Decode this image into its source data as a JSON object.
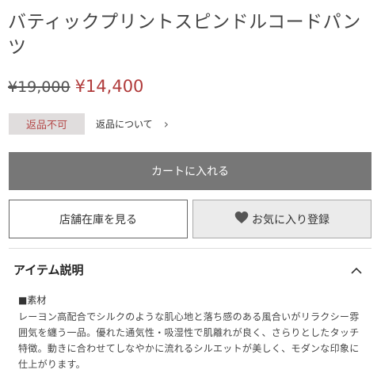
{
  "product": {
    "title": "バティックプリントスピンドルコードパンツ",
    "old_price": "¥19,000",
    "new_price": "¥14,400"
  },
  "returns": {
    "badge": "返品不可",
    "link": "返品について"
  },
  "buttons": {
    "cart": "カートに入れる",
    "store_stock": "店舗在庫を見る",
    "favorite": "お気に入り登録"
  },
  "item_section": {
    "title": "アイテム説明",
    "material_heading": "■素材",
    "description": "レーヨン高配合でシルクのような肌心地と落ち感のある風合いがリラクシー雰囲気を纏う一品。優れた通気性・吸湿性で肌離れが良く、さらりとしたタッチ特徴。動きに合わせてしなやかに流れるシルエットが美しく、モダンな印象に仕上がります。"
  },
  "icons": {
    "chevron_right": "chevron-right-icon",
    "heart": "heart-icon",
    "chevron_up": "chevron-up-icon"
  },
  "colors": {
    "sale_price": "#b03a3a",
    "badge_bg": "#e0dddd",
    "badge_text": "#b54a4a",
    "cart_bg": "#777777",
    "fav_bg": "#ebebeb",
    "heart": "#555555"
  }
}
